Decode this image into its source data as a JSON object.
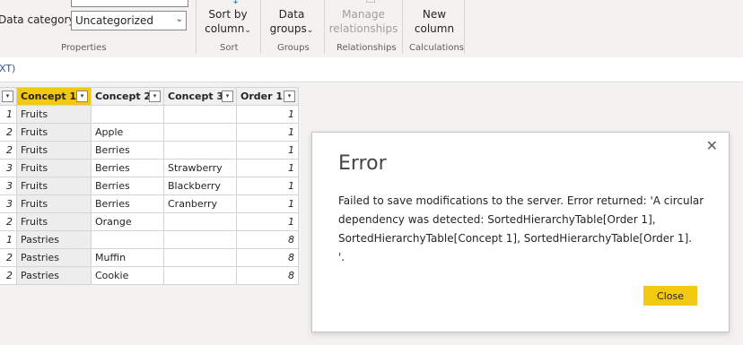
{
  "ribbon": {
    "data_category_label": "Data category",
    "data_category_value": "Uncategorized",
    "groups": {
      "properties": "Properties",
      "sort": "Sort",
      "groups": "Groups",
      "relationships": "Relationships",
      "calculations": "Calculations"
    },
    "sort_by_line1": "Sort by",
    "sort_by_line2": "column",
    "data_groups_line1": "Data",
    "data_groups_line2": "groups",
    "manage_rel_line1": "Manage",
    "manage_rel_line2": "relationships",
    "new_column_line1": "New",
    "new_column_line2": "column",
    "chevron": "⌄"
  },
  "formula": {
    "text": "XT)"
  },
  "table": {
    "headers": [
      "",
      "Concept 1",
      "Concept 2",
      "Concept 3",
      "Order 1"
    ],
    "rows": [
      [
        "1",
        "Fruits",
        "",
        "",
        "1"
      ],
      [
        "2",
        "Fruits",
        "Apple",
        "",
        "1"
      ],
      [
        "2",
        "Fruits",
        "Berries",
        "",
        "1"
      ],
      [
        "3",
        "Fruits",
        "Berries",
        "Strawberry",
        "1"
      ],
      [
        "3",
        "Fruits",
        "Berries",
        "Blackberry",
        "1"
      ],
      [
        "3",
        "Fruits",
        "Berries",
        "Cranberry",
        "1"
      ],
      [
        "2",
        "Fruits",
        "Orange",
        "",
        "1"
      ],
      [
        "1",
        "Pastries",
        "",
        "",
        "8"
      ],
      [
        "2",
        "Pastries",
        "Muffin",
        "",
        "8"
      ],
      [
        "2",
        "Pastries",
        "Cookie",
        "",
        "8"
      ]
    ]
  },
  "dialog": {
    "title": "Error",
    "message": "Failed to save modifications to the server. Error returned: 'A circular dependency was detected: SortedHierarchyTable[Order 1], SortedHierarchyTable[Concept 1], SortedHierarchyTable[Order 1].\n'.",
    "close_button": "Close",
    "close_icon": "✕"
  }
}
